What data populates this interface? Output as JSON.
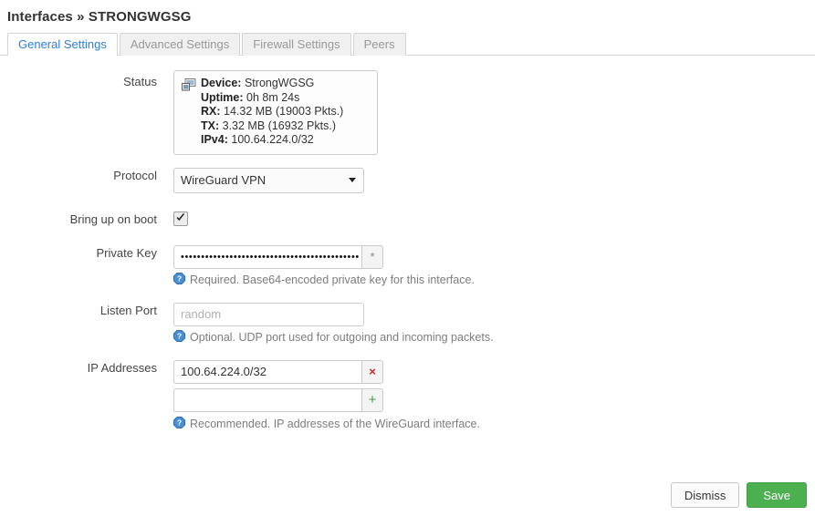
{
  "header": {
    "section": "Interfaces",
    "separator": "»",
    "name": "STRONGWGSG"
  },
  "tabs": [
    {
      "label": "General Settings",
      "active": true
    },
    {
      "label": "Advanced Settings",
      "active": false
    },
    {
      "label": "Firewall Settings",
      "active": false
    },
    {
      "label": "Peers",
      "active": false
    }
  ],
  "form": {
    "status": {
      "label": "Status",
      "icon": "device-icon",
      "fields": [
        {
          "key": "Device:",
          "value": "StrongWGSG"
        },
        {
          "key": "Uptime:",
          "value": "0h 8m 24s"
        },
        {
          "key": "RX:",
          "value": "14.32 MB (19003 Pkts.)"
        },
        {
          "key": "TX:",
          "value": "3.32 MB (16932 Pkts.)"
        },
        {
          "key": "IPv4:",
          "value": "100.64.224.0/32"
        }
      ]
    },
    "protocol": {
      "label": "Protocol",
      "value": "WireGuard VPN"
    },
    "bring_up_on_boot": {
      "label": "Bring up on boot",
      "checked": true
    },
    "private_key": {
      "label": "Private Key",
      "value": "••••••••••••••••••••••••••••••••••••••••••••",
      "reveal_label": "*",
      "hint": "Required. Base64-encoded private key for this interface."
    },
    "listen_port": {
      "label": "Listen Port",
      "value": "",
      "placeholder": "random",
      "hint": "Optional. UDP port used for outgoing and incoming packets."
    },
    "ip_addresses": {
      "label": "IP Addresses",
      "entries": [
        {
          "value": "100.64.224.0/32",
          "button": "×",
          "action": "remove"
        },
        {
          "value": "",
          "button": "+",
          "action": "add"
        }
      ],
      "hint": "Recommended. IP addresses of the WireGuard interface."
    }
  },
  "footer": {
    "dismiss_label": "Dismiss",
    "save_label": "Save"
  },
  "colors": {
    "accent_blue": "#2a7fdc",
    "save_green": "#4caf50",
    "remove_red": "#cc2222",
    "add_green": "#43a047",
    "hint_gray": "#7d7d7d"
  }
}
